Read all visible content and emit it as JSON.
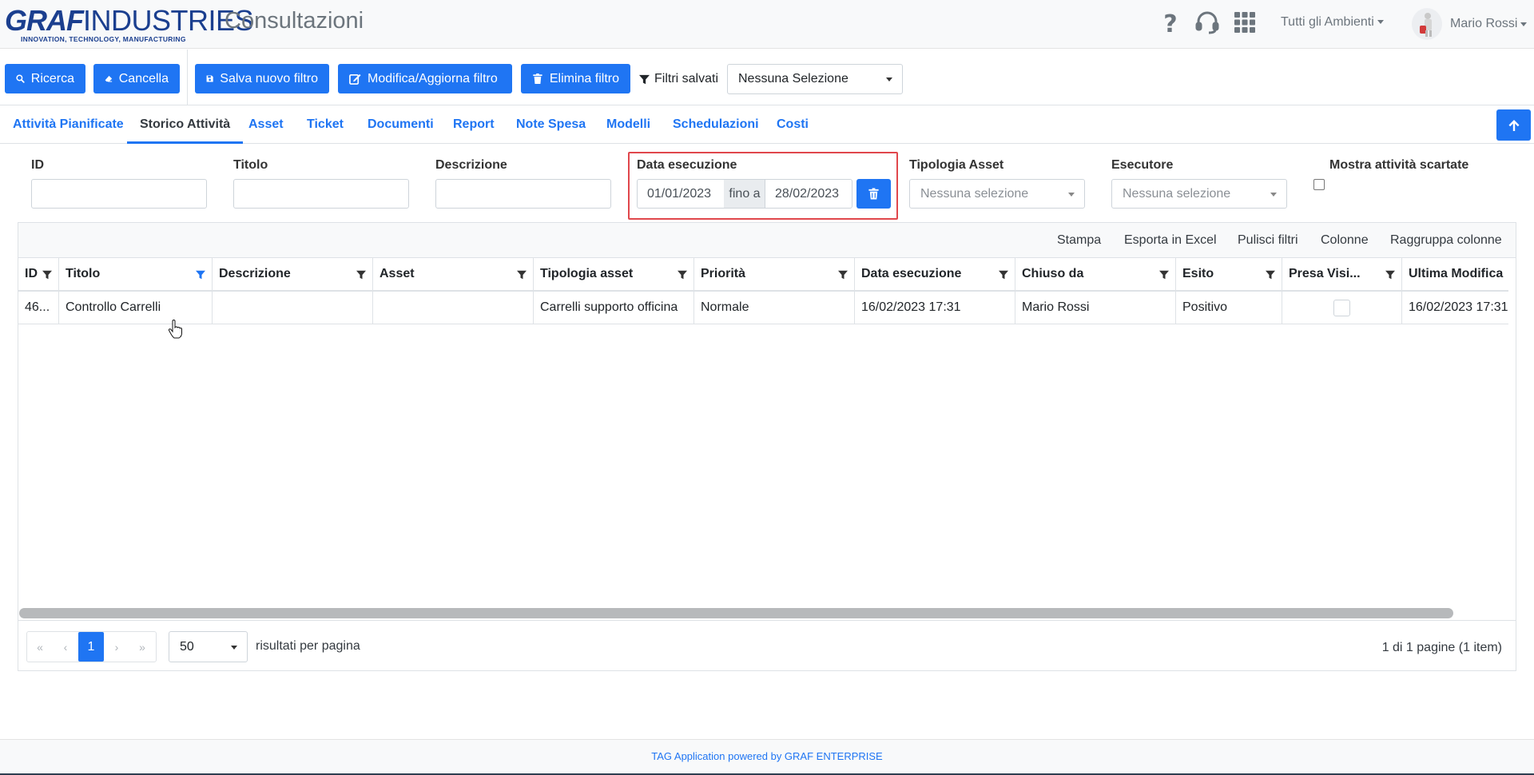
{
  "header": {
    "logo_main_bold": "GRAF",
    "logo_main_light": "INDUSTRIES",
    "logo_tagline": "INNOVATION, TECHNOLOGY, MANUFACTURING",
    "app_title": "Consultazioni",
    "icons": [
      "help-icon",
      "headset-icon",
      "apps-grid-icon"
    ],
    "environment_menu": "Tutti gli Ambienti",
    "user_name": "Mario Rossi"
  },
  "toolbar": {
    "search_label": "Ricerca",
    "clear_label": "Cancella",
    "save_filter_label": "Salva nuovo filtro",
    "edit_filter_label": "Modifica/Aggiorna filtro",
    "delete_filter_label": "Elimina filtro",
    "saved_filters_label": "Filtri salvati",
    "saved_filters_value": "Nessuna Selezione"
  },
  "tabs": [
    {
      "label": "Attività Pianificate",
      "active": false
    },
    {
      "label": "Storico Attività",
      "active": true
    },
    {
      "label": "Asset",
      "active": false
    },
    {
      "label": "Ticket",
      "active": false
    },
    {
      "label": "Documenti",
      "active": false
    },
    {
      "label": "Report",
      "active": false
    },
    {
      "label": "Note Spesa",
      "active": false
    },
    {
      "label": "Modelli",
      "active": false
    },
    {
      "label": "Schedulazioni",
      "active": false
    },
    {
      "label": "Costi",
      "active": false
    }
  ],
  "filters": {
    "id_label": "ID",
    "title_label": "Titolo",
    "description_label": "Descrizione",
    "date_label": "Data esecuzione",
    "date_from": "01/01/2023",
    "date_to_separator": "fino a",
    "date_to": "28/02/2023",
    "asset_type_label": "Tipologia Asset",
    "asset_type_placeholder": "Nessuna selezione",
    "executor_label": "Esecutore",
    "executor_placeholder": "Nessuna selezione",
    "show_discarded_label": "Mostra attività scartate"
  },
  "grid": {
    "toolbar": [
      "Stampa",
      "Esporta in Excel",
      "Pulisci filtri",
      "Colonne",
      "Raggruppa colonne"
    ],
    "columns": [
      "ID",
      "Titolo",
      "Descrizione",
      "Asset",
      "Tipologia asset",
      "Priorità",
      "Data esecuzione",
      "Chiuso da",
      "Esito",
      "Presa Visi...",
      "Ultima Modifica"
    ],
    "rows": [
      {
        "id": "46...",
        "title": "Controllo Carrelli",
        "description": "",
        "asset": "",
        "asset_type": "Carrelli supporto officina",
        "priority": "Normale",
        "execution_date": "16/02/2023 17:31",
        "closed_by": "Mario Rossi",
        "outcome": "Positivo",
        "acknowledged": false,
        "last_modified": "16/02/2023 17:31"
      }
    ],
    "pager": {
      "current_page": "1",
      "page_size": "50",
      "page_size_label": "risultati per pagina",
      "page_info": "1 di 1 pagine (1 item)"
    }
  },
  "footer": {
    "text": "TAG Application powered by GRAF ENTERPRISE"
  },
  "colors": {
    "primary": "#1f75f3",
    "highlight_box": "#e0474c",
    "logo": "#1b3f8f"
  }
}
